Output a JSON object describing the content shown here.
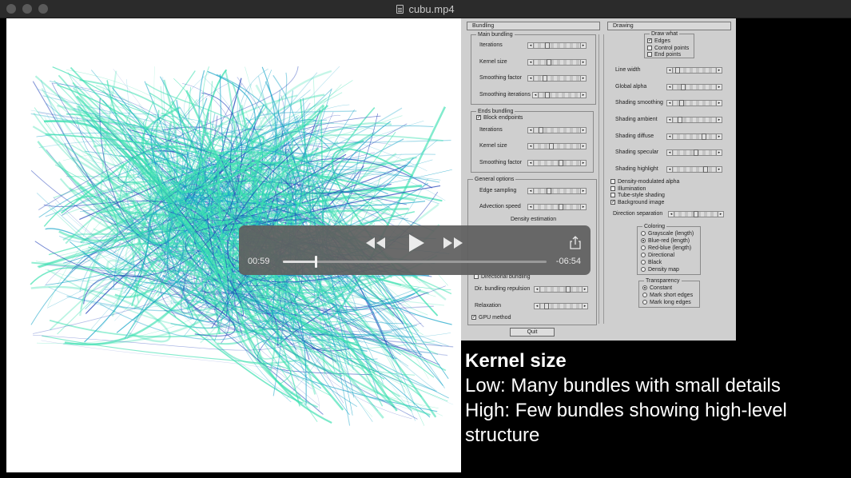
{
  "window": {
    "title": "cubu.mp4"
  },
  "player": {
    "elapsed": "00:59",
    "remaining": "-06:54",
    "progress": 0.125,
    "icons": [
      "rewind-icon",
      "play-icon",
      "fast-forward-icon",
      "share-icon"
    ]
  },
  "gui": {
    "bundling_panel": "Bundling",
    "drawing_panel": "Drawing",
    "main_bundling": {
      "title": "Main bundling",
      "rows": [
        {
          "label": "Iterations",
          "level": 0.25
        },
        {
          "label": "Kernel size",
          "level": 0.3
        },
        {
          "label": "Smoothing factor",
          "level": 0.2
        },
        {
          "label": "Smoothing iterations",
          "level": 0.15
        }
      ]
    },
    "ends_bundling": {
      "title": "Ends bundling",
      "block_endpoints": "Block endpoints",
      "rows": [
        {
          "label": "Iterations",
          "level": 0.1
        },
        {
          "label": "Kernel size",
          "level": 0.35
        },
        {
          "label": "Smoothing factor",
          "level": 0.6
        }
      ]
    },
    "general_options": {
      "title": "General options",
      "rows": [
        {
          "label": "Edge sampling",
          "level": 0.3
        },
        {
          "label": "Advection speed",
          "level": 0.6
        }
      ],
      "density_estimation": "Density estimation"
    },
    "directional": {
      "checkbox": "Directional bundling",
      "rows": [
        {
          "label": "Dir. bundling repulsion",
          "level": 0.7
        },
        {
          "label": "Relaxation",
          "level": 0.1
        }
      ]
    },
    "gpu_method": "GPU method",
    "quit": "Quit",
    "draw_what": {
      "title": "Draw what",
      "options": [
        {
          "label": "Edges",
          "checked": true
        },
        {
          "label": "Control points",
          "checked": false
        },
        {
          "label": "End points",
          "checked": false
        }
      ]
    },
    "drawing_rows": [
      {
        "label": "Line width",
        "level": 0.05
      },
      {
        "label": "Global alpha",
        "level": 0.2
      },
      {
        "label": "Shading smoothing",
        "level": 0.15
      },
      {
        "label": "Shading ambient",
        "level": 0.1
      },
      {
        "label": "Shading diffuse",
        "level": 0.75
      },
      {
        "label": "Shading specular",
        "level": 0.55
      },
      {
        "label": "Shading highlight",
        "level": 0.8
      }
    ],
    "drawing_checks": [
      {
        "label": "Density-modulated alpha",
        "checked": false
      },
      {
        "label": "Illumination",
        "checked": false
      },
      {
        "label": "Tube-style shading",
        "checked": false
      },
      {
        "label": "Background image",
        "checked": true
      }
    ],
    "direction_separation": {
      "label": "Direction separation",
      "level": 0.5
    },
    "coloring": {
      "title": "Coloring",
      "options": [
        {
          "label": "Grayscale (length)",
          "selected": false
        },
        {
          "label": "Blue-red (length)",
          "selected": true
        },
        {
          "label": "Red-blue (length)",
          "selected": false
        },
        {
          "label": "Directional",
          "selected": false
        },
        {
          "label": "Black",
          "selected": false
        },
        {
          "label": "Density map",
          "selected": false
        }
      ]
    },
    "transparency": {
      "title": "Transparency",
      "options": [
        {
          "label": "Constant",
          "selected": true
        },
        {
          "label": "Mark short edges",
          "selected": false
        },
        {
          "label": "Mark long edges",
          "selected": false
        }
      ]
    }
  },
  "caption": {
    "title": "Kernel size",
    "lines": [
      "Low: Many bundles with small details",
      "High: Few bundles showing high-level structure"
    ]
  },
  "colors": {
    "edge_light": "#3ce0b0",
    "edge_mid": "#1aa6c9",
    "edge_dark": "#2040b8"
  }
}
